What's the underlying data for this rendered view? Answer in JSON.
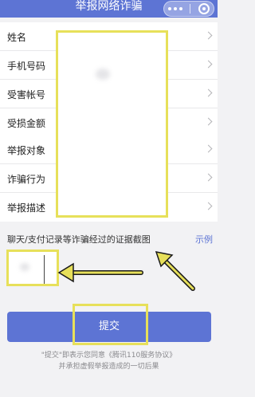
{
  "header": {
    "title": "举报网络诈骗",
    "more_icon": "more-dots-icon",
    "close_icon": "target-close-icon"
  },
  "form": {
    "group1": [
      {
        "label": "姓名"
      },
      {
        "label": "手机号码"
      },
      {
        "label": "受害帐号"
      },
      {
        "label": "受损金额"
      }
    ],
    "group2": [
      {
        "label": "举报对象"
      },
      {
        "label": "诈骗行为"
      },
      {
        "label": "举报描述"
      }
    ]
  },
  "evidence": {
    "label": "聊天/支付记录等诈骗经过的证据截图",
    "example_link": "示例"
  },
  "submit": {
    "label": "提交"
  },
  "footer": {
    "line1": "\"提交\"即表示您同意《腾讯110服务协议》",
    "line2": "并承担虚假举报造成的一切后果"
  },
  "colors": {
    "primary": "#5d74d4",
    "highlight": "#e7e05a",
    "background": "#f2f2f4"
  }
}
